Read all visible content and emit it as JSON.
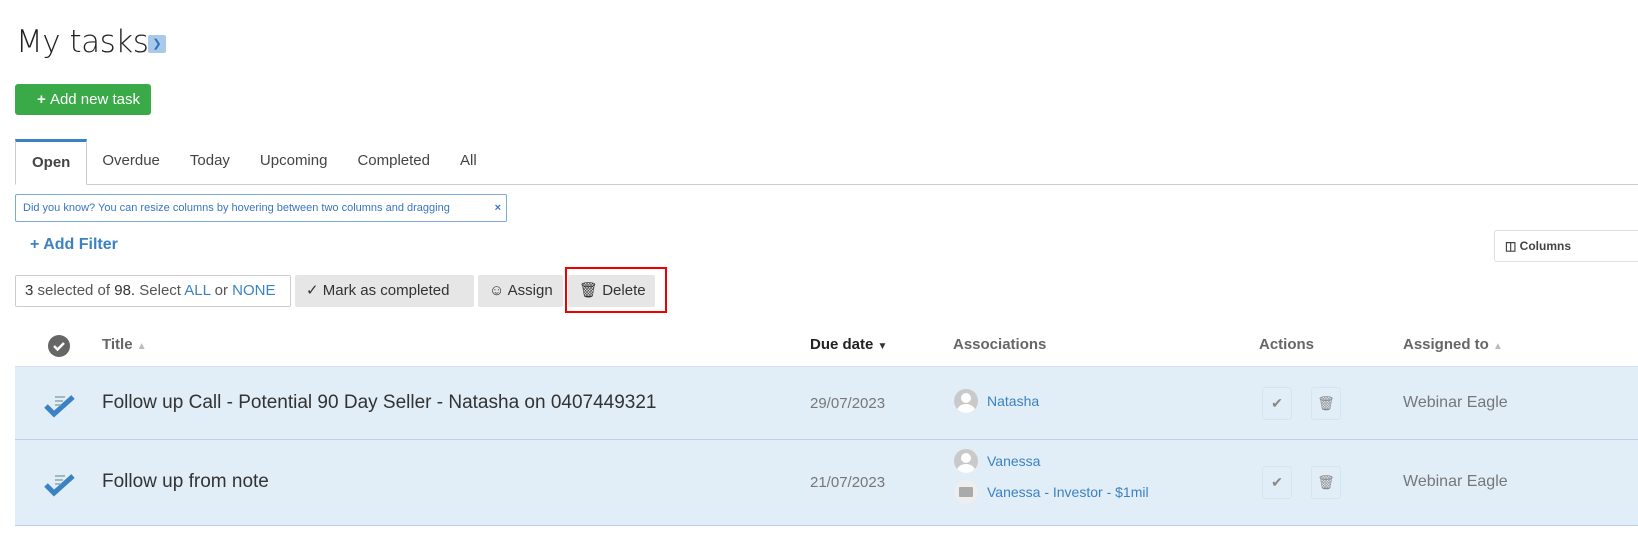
{
  "header": {
    "title": "My tasks",
    "add_button": "Add new task"
  },
  "tabs": [
    "Open",
    "Overdue",
    "Today",
    "Upcoming",
    "Completed",
    "All"
  ],
  "tip": {
    "text": "Did you know? You can resize columns by hovering between two columns and dragging",
    "close": "×"
  },
  "filter": {
    "label": "Add Filter"
  },
  "columns_button": "Columns",
  "selection": {
    "count": "3",
    "mid": " selected of ",
    "total": "98.",
    "select": " Select ",
    "all": "ALL",
    "or": " or ",
    "none": "NONE"
  },
  "bulk": {
    "complete": "Mark as completed",
    "assign": "Assign",
    "delete": "Delete"
  },
  "table": {
    "headers": {
      "title": "Title",
      "due": "Due date",
      "associations": "Associations",
      "actions": "Actions",
      "assigned": "Assigned to"
    },
    "rows": [
      {
        "title": "Follow up Call - Potential 90 Day Seller - Natasha on 0407449321",
        "due": "29/07/2023",
        "associations": [
          "Natasha"
        ],
        "assigned": "Webinar Eagle"
      },
      {
        "title": "Follow up from note",
        "due": "21/07/2023",
        "associations": [
          "Vanessa",
          "Vanessa - Investor - $1mil"
        ],
        "assigned": "Webinar Eagle"
      }
    ]
  },
  "colors": {
    "accent": "#3b82c4",
    "green": "#3aaa48",
    "row_bg": "#e1edf7",
    "highlight": "#e00000"
  }
}
